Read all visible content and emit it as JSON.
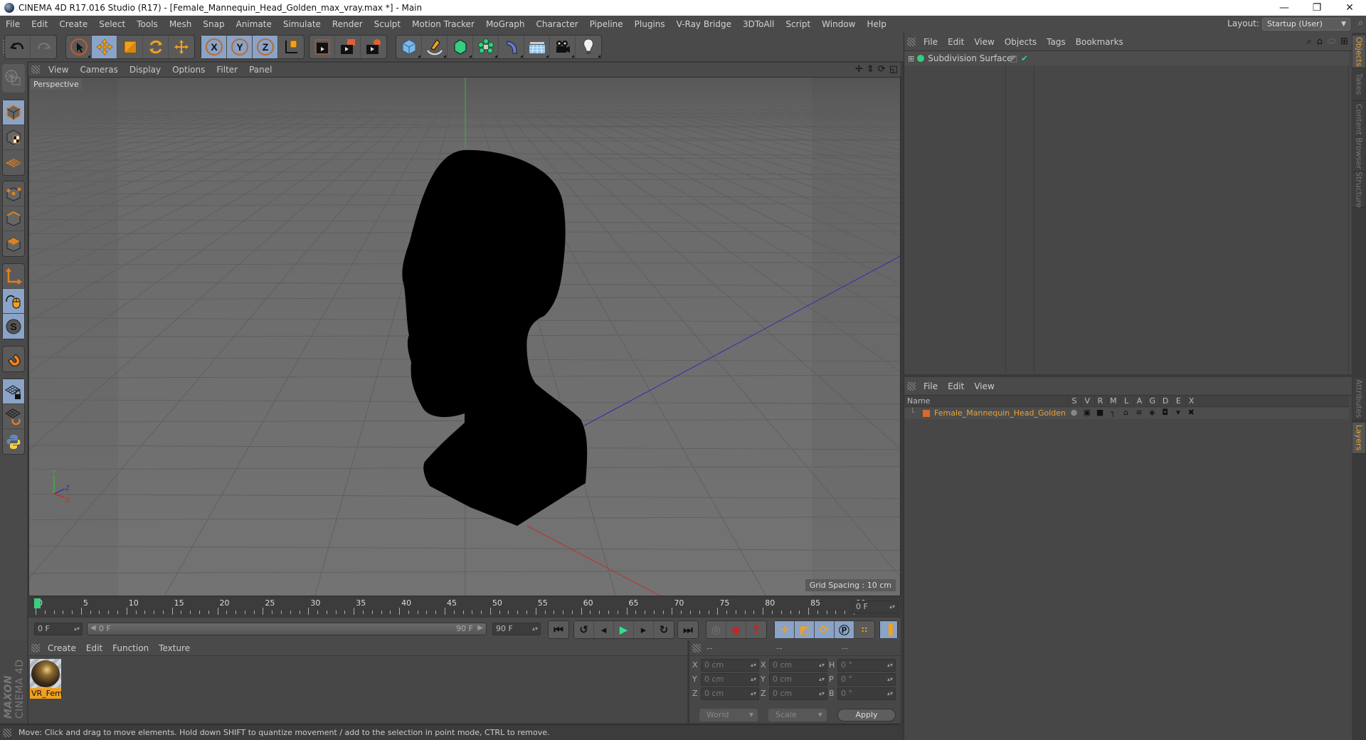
{
  "window": {
    "title": "CINEMA 4D R17.016 Studio (R17) - [Female_Mannequin_Head_Golden_max_vray.max *] - Main",
    "controls": [
      "minimize-icon",
      "restore-icon",
      "close-icon"
    ]
  },
  "menubar": {
    "items": [
      "File",
      "Edit",
      "Create",
      "Select",
      "Tools",
      "Mesh",
      "Snap",
      "Animate",
      "Simulate",
      "Render",
      "Sculpt",
      "Motion Tracker",
      "MoGraph",
      "Character",
      "Pipeline",
      "Plugins",
      "V-Ray Bridge",
      "3DToAll",
      "Script",
      "Window",
      "Help"
    ],
    "layout_label": "Layout:",
    "layout_value": "Startup (User)"
  },
  "toolbar": {
    "groups": [
      {
        "name": "history",
        "buttons": [
          {
            "icon": "undo-icon",
            "active": false
          },
          {
            "icon": "redo-icon",
            "active": false
          }
        ]
      },
      {
        "name": "transform",
        "buttons": [
          {
            "icon": "live-selection-icon",
            "active": false
          },
          {
            "icon": "move-icon",
            "active": true
          },
          {
            "icon": "scale-icon",
            "active": false
          },
          {
            "icon": "rotate-icon",
            "active": false
          },
          {
            "icon": "recent-tool-icon",
            "active": false
          }
        ]
      },
      {
        "name": "axis-lock",
        "buttons": [
          {
            "icon": "x-axis-icon",
            "active": true
          },
          {
            "icon": "y-axis-icon",
            "active": true
          },
          {
            "icon": "z-axis-icon",
            "active": true
          },
          {
            "icon": "coordinate-system-icon",
            "active": false
          }
        ]
      },
      {
        "name": "render",
        "buttons": [
          {
            "icon": "render-view-icon",
            "active": false
          },
          {
            "icon": "render-picture-viewer-icon",
            "active": false
          },
          {
            "icon": "render-settings-icon",
            "active": false
          }
        ]
      },
      {
        "name": "objects",
        "buttons": [
          {
            "icon": "cube-icon",
            "active": false
          },
          {
            "icon": "pen-spline-icon",
            "active": false
          },
          {
            "icon": "subdivision-icon",
            "active": false
          },
          {
            "icon": "mograph-cloner-icon",
            "active": false
          },
          {
            "icon": "deformer-bend-icon",
            "active": false
          },
          {
            "icon": "floor-icon",
            "active": false
          },
          {
            "icon": "camera-icon",
            "active": false
          },
          {
            "icon": "light-icon",
            "active": false
          }
        ]
      }
    ]
  },
  "left_tools": [
    {
      "icon": "make-editable-icon",
      "active": false
    },
    {
      "icon": "model-mode-icon",
      "active": true
    },
    {
      "icon": "texture-mode-icon",
      "active": false
    },
    {
      "icon": "workplane-mode-icon",
      "active": false
    },
    {
      "icon": "points-mode-icon",
      "active": false
    },
    {
      "icon": "edges-mode-icon",
      "active": false
    },
    {
      "icon": "polygons-mode-icon",
      "active": false
    },
    {
      "icon": "axis-mode-icon",
      "active": false
    },
    {
      "icon": "tweak-mode-icon",
      "active": true
    },
    {
      "icon": "solo-mode-icon",
      "active": true
    },
    {
      "icon": "snap-magnet-icon",
      "active": false
    },
    {
      "icon": "locked-workplane-icon",
      "active": true
    },
    {
      "icon": "planar-workplane-icon",
      "active": false
    },
    {
      "icon": "python-icon",
      "active": false
    }
  ],
  "viewport": {
    "menu": [
      "View",
      "Cameras",
      "Display",
      "Options",
      "Filter",
      "Panel"
    ],
    "camera_label": "Perspective",
    "grid_spacing": "Grid Spacing : 10 cm",
    "nav_icons": [
      "pan-icon",
      "dolly-icon",
      "orbit-icon",
      "toggle-view-icon"
    ],
    "axis_labels": {
      "y": "Y",
      "z": "Z",
      "x": "X"
    },
    "colors": {
      "y_axis": "#3fae3f",
      "x_axis": "#c03030",
      "z_axis": "#3030b0",
      "background": "#6e6e6e"
    }
  },
  "timeline": {
    "ticks": [
      "0",
      "5",
      "10",
      "15",
      "20",
      "25",
      "30",
      "35",
      "40",
      "45",
      "50",
      "55",
      "60",
      "65",
      "70",
      "75",
      "80",
      "85",
      "90"
    ],
    "current_frame_field": "0 F",
    "start_field": "0 F",
    "range_start": "0 F",
    "range_end": "90 F",
    "end_field": "90 F",
    "playhead_frame": 0,
    "max_frame": 90,
    "playhead_color": "#3ccf7f"
  },
  "playback": {
    "buttons": [
      "go-to-start-icon",
      "prev-key-icon",
      "prev-frame-icon",
      "play-icon",
      "next-frame-icon",
      "next-key-icon",
      "go-to-end-icon"
    ],
    "key_buttons": [
      "record-keys-disabled-icon",
      "autokey-icon",
      "keyframe-selection-icon"
    ],
    "track_buttons": [
      "move-track-icon",
      "scale-track-icon",
      "rotation-track-icon",
      "param-track-icon",
      "pla-track-icon"
    ],
    "timeline_button": "timeline-window-icon"
  },
  "material_manager": {
    "menu": [
      "Create",
      "Edit",
      "Function",
      "Texture"
    ],
    "materials": [
      {
        "label": "VR_Fem",
        "selected": true
      }
    ]
  },
  "coordinates": {
    "headers": [
      "--",
      "--",
      "--"
    ],
    "rows": [
      {
        "pos_label": "X",
        "pos": "0 cm",
        "size_label": "X",
        "size": "0 cm",
        "rot_label": "H",
        "rot": "0 °"
      },
      {
        "pos_label": "Y",
        "pos": "0 cm",
        "size_label": "Y",
        "size": "0 cm",
        "rot_label": "P",
        "rot": "0 °"
      },
      {
        "pos_label": "Z",
        "pos": "0 cm",
        "size_label": "Z",
        "size": "0 cm",
        "rot_label": "B",
        "rot": "0 °"
      }
    ],
    "mode_select": "World",
    "size_select": "Scale",
    "apply_label": "Apply"
  },
  "brand": {
    "maxon": "MAXON",
    "product": "CINEMA 4D"
  },
  "status_bar": "Move: Click and drag to move elements. Hold down SHIFT to quantize movement / add to the selection in point mode, CTRL to remove.",
  "object_manager": {
    "menu": [
      "File",
      "Edit",
      "View",
      "Objects",
      "Tags",
      "Bookmarks"
    ],
    "header_icons": [
      "search-icon",
      "home-icon",
      "eye-icon",
      "new-view-icon"
    ],
    "objects": [
      {
        "name": "Subdivision Surface",
        "icon": "subdivision-icon",
        "tags": [
          "layer-tag",
          "check-tag"
        ]
      }
    ]
  },
  "layer_manager": {
    "menu": [
      "File",
      "Edit",
      "View"
    ],
    "columns": [
      "Name",
      "S",
      "V",
      "R",
      "M",
      "L",
      "A",
      "G",
      "D",
      "E",
      "X"
    ],
    "layers": [
      {
        "name": "Female_Mannequin_Head_Golden",
        "color": "#d86a2a"
      }
    ]
  },
  "right_tabs": {
    "top": [
      {
        "label": "Objects",
        "active": true
      },
      {
        "label": "Takes",
        "active": false
      },
      {
        "label": "Content Browser",
        "active": false
      },
      {
        "label": "Structure",
        "active": false
      }
    ],
    "bottom": [
      {
        "label": "Attributes",
        "active": false
      },
      {
        "label": "Layers",
        "active": true
      }
    ]
  }
}
